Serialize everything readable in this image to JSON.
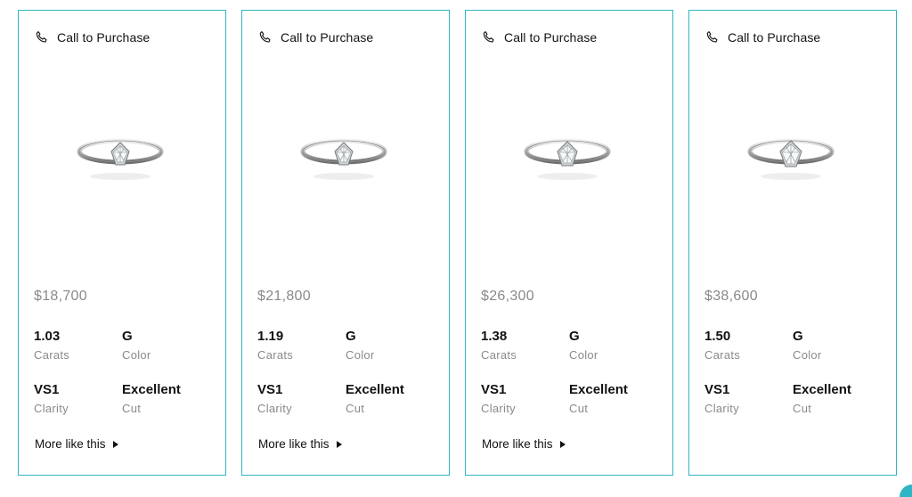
{
  "colors": {
    "accent": "#2fb6c4",
    "muted": "#8a8a8a",
    "text": "#111111"
  },
  "cards": [
    {
      "call_label": "Call to Purchase",
      "price": "$18,700",
      "carats": "1.03",
      "carats_label": "Carats",
      "color": "G",
      "color_label": "Color",
      "clarity": "VS1",
      "clarity_label": "Clarity",
      "cut": "Excellent",
      "cut_label": "Cut",
      "more_label": "More like this"
    },
    {
      "call_label": "Call to Purchase",
      "price": "$21,800",
      "carats": "1.19",
      "carats_label": "Carats",
      "color": "G",
      "color_label": "Color",
      "clarity": "VS1",
      "clarity_label": "Clarity",
      "cut": "Excellent",
      "cut_label": "Cut",
      "more_label": "More like this"
    },
    {
      "call_label": "Call to Purchase",
      "price": "$26,300",
      "carats": "1.38",
      "carats_label": "Carats",
      "color": "G",
      "color_label": "Color",
      "clarity": "VS1",
      "clarity_label": "Clarity",
      "cut": "Excellent",
      "cut_label": "Cut",
      "more_label": "More like this"
    },
    {
      "call_label": "Call to Purchase",
      "price": "$38,600",
      "carats": "1.50",
      "carats_label": "Carats",
      "color": "G",
      "color_label": "Color",
      "clarity": "VS1",
      "clarity_label": "Clarity",
      "cut": "Excellent",
      "cut_label": "Cut"
    }
  ],
  "icons": {
    "call": "phone-icon",
    "product": "ring-image",
    "more": "caret-right-icon"
  }
}
